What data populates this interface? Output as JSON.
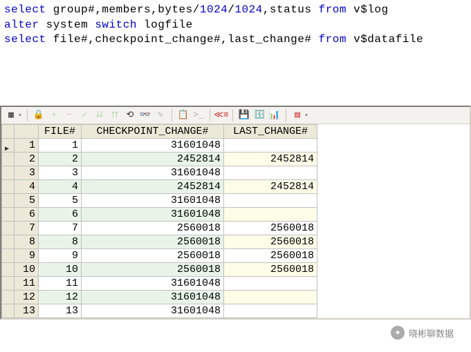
{
  "sql": {
    "line1": {
      "p1": "select ",
      "p2": "group#,members,bytes",
      "p3": "/",
      "p4": "1024",
      "p5": "/",
      "p6": "1024",
      "p7": ",status ",
      "p8": "from ",
      "p9": "v$log"
    },
    "line2": {
      "p1": "alter ",
      "p2": "system ",
      "p3": "switch ",
      "p4": "logfile"
    },
    "line3": {
      "p1": "select ",
      "p2": "file#,checkpoint_change#,last_change# ",
      "p3": "from ",
      "p4": "v$datafile"
    }
  },
  "toolbar": {
    "grid": "▦",
    "lock": "🔒",
    "plus": "+",
    "minus": "−",
    "check": "✓",
    "dblarrow_down": "⮇",
    "dblarrow_up": "⮅",
    "refresh": "↻",
    "undo": "⟲",
    "binoc": "👓",
    "highlighter": "✎",
    "copy": "📋",
    "export": ">_",
    "report": "🗐",
    "chain": "≪≡",
    "save": "💾",
    "db": "🗄",
    "chart": "📊",
    "listred": "▤",
    "dd": "▾"
  },
  "columns": [
    "FILE#",
    "CHECKPOINT_CHANGE#",
    "LAST_CHANGE#"
  ],
  "rows": [
    {
      "n": 1,
      "file": 1,
      "chk": 31601048,
      "last": ""
    },
    {
      "n": 2,
      "file": 2,
      "chk": 2452814,
      "last": 2452814
    },
    {
      "n": 3,
      "file": 3,
      "chk": 31601048,
      "last": ""
    },
    {
      "n": 4,
      "file": 4,
      "chk": 2452814,
      "last": 2452814
    },
    {
      "n": 5,
      "file": 5,
      "chk": 31601048,
      "last": ""
    },
    {
      "n": 6,
      "file": 6,
      "chk": 31601048,
      "last": ""
    },
    {
      "n": 7,
      "file": 7,
      "chk": 2560018,
      "last": 2560018
    },
    {
      "n": 8,
      "file": 8,
      "chk": 2560018,
      "last": 2560018
    },
    {
      "n": 9,
      "file": 9,
      "chk": 2560018,
      "last": 2560018
    },
    {
      "n": 10,
      "file": 10,
      "chk": 2560018,
      "last": 2560018
    },
    {
      "n": 11,
      "file": 11,
      "chk": 31601048,
      "last": ""
    },
    {
      "n": 12,
      "file": 12,
      "chk": 31601048,
      "last": ""
    },
    {
      "n": 13,
      "file": 13,
      "chk": 31601048,
      "last": ""
    }
  ],
  "watermark": "晓彬聊数据"
}
